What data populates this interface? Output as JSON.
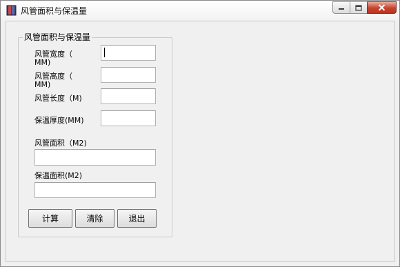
{
  "window": {
    "title": "风管面积与保温量",
    "icon": "app-book-icon"
  },
  "group": {
    "title": "风管面积与保温量"
  },
  "fields": {
    "width": {
      "label_line1": "风管宽度（",
      "label_line2": "MM)",
      "value": ""
    },
    "height": {
      "label_line1": "风管高度（",
      "label_line2": "MM)",
      "value": ""
    },
    "length": {
      "label": "风管长度（M)",
      "value": ""
    },
    "insulation_thickness": {
      "label": "保温厚度(MM)",
      "value": ""
    },
    "duct_area": {
      "label": "风管面积（M2)",
      "value": ""
    },
    "insulation_area": {
      "label": "保温面积(M2)",
      "value": ""
    }
  },
  "buttons": {
    "calculate": "计算",
    "clear": "清除",
    "exit": "退出"
  },
  "colors": {
    "close_button": "#c7432e",
    "window_bg": "#f0f0f0"
  }
}
